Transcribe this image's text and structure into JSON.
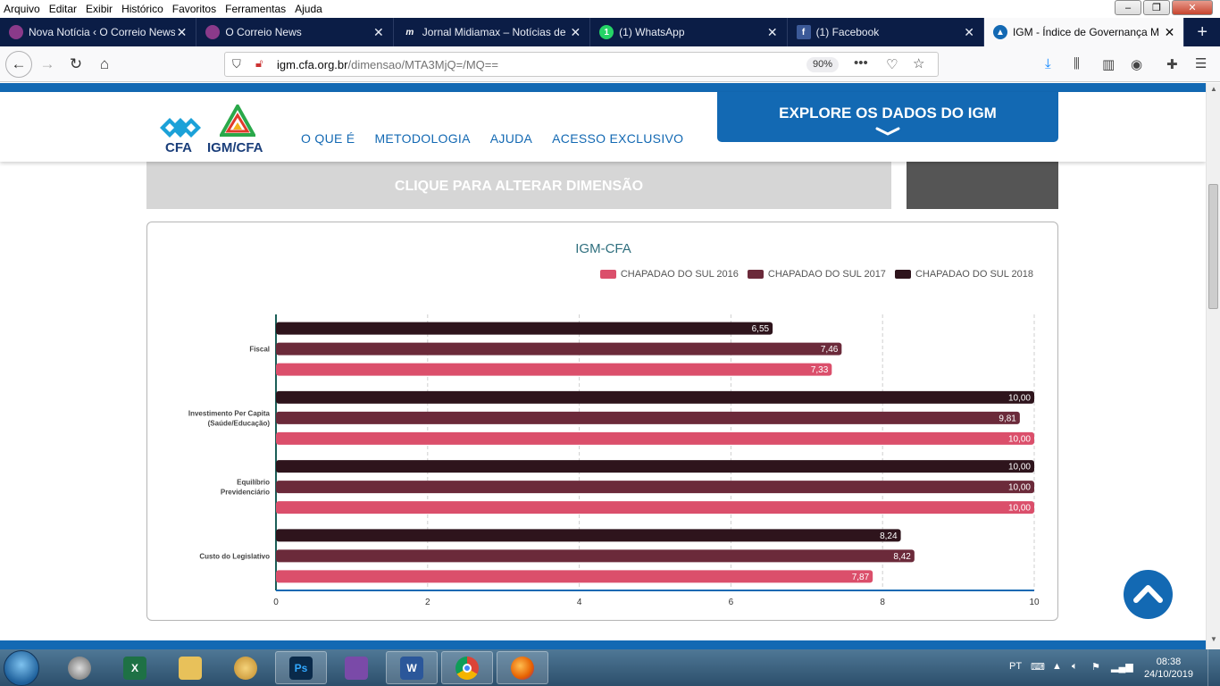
{
  "menubar": {
    "items": [
      "Arquivo",
      "Editar",
      "Exibir",
      "Histórico",
      "Favoritos",
      "Ferramentas",
      "Ajuda"
    ]
  },
  "tabs": [
    {
      "label": "Nova Notícia ‹ O Correio News",
      "icon": "correio-news-icon",
      "color": "#8a3a8a",
      "active": false
    },
    {
      "label": "O Correio News",
      "icon": "correio-news-icon",
      "color": "#8a3a8a",
      "active": false
    },
    {
      "label": "Jornal Midiamax – Notícias de",
      "icon": "midiamax-icon",
      "color": "#ffffff",
      "active": false
    },
    {
      "label": "(1) WhatsApp",
      "icon": "whatsapp-icon",
      "color": "#25d366",
      "active": false
    },
    {
      "label": "(1) Facebook",
      "icon": "facebook-icon",
      "color": "#3b5998",
      "active": false
    },
    {
      "label": "IGM - Índice de Governança M",
      "icon": "igm-icon",
      "color": "#1369b3",
      "active": true
    }
  ],
  "navbar": {
    "url_domain": "igm.cfa.org.br",
    "url_path": "/dimensao/MTA3MjQ=/MQ==",
    "zoom": "90%"
  },
  "site": {
    "logo_cfa_text": "CFA",
    "logo_igm_text": "IGM/CFA",
    "nav": [
      "O QUE É",
      "METODOLOGIA",
      "AJUDA",
      "ACESSO EXCLUSIVO"
    ],
    "explore_label": "EXPLORE OS DADOS DO IGM",
    "dimension_button": "CLIQUE PARA ALTERAR DIMENSÃO",
    "brand_color": "#1369b3"
  },
  "chart_data": {
    "type": "bar",
    "orientation": "horizontal",
    "title": "IGM-CFA",
    "categories": [
      "Fiscal",
      "Investimento Per Capita (Saúde/Educação)",
      "Equilíbrio Previdenciário",
      "Custo do Legislativo"
    ],
    "category_lines": [
      [
        "Fiscal"
      ],
      [
        "Investimento Per Capita",
        "(Saúde/Educação)"
      ],
      [
        "Equilíbrio",
        "Previdenciário"
      ],
      [
        "Custo do Legislativo"
      ]
    ],
    "series": [
      {
        "name": "CHAPADAO DO SUL 2018",
        "color": "#2e141c",
        "values": [
          6.55,
          10.0,
          10.0,
          8.24
        ],
        "labels": [
          "6,55",
          "10,00",
          "10,00",
          "8,24"
        ]
      },
      {
        "name": "CHAPADAO DO SUL 2017",
        "color": "#6b2a3a",
        "values": [
          7.46,
          9.81,
          10.0,
          8.42
        ],
        "labels": [
          "7,46",
          "9,81",
          "10,00",
          "8,42"
        ]
      },
      {
        "name": "CHAPADAO DO SUL 2016",
        "color": "#db4f6b",
        "values": [
          7.33,
          10.0,
          10.0,
          7.87
        ],
        "labels": [
          "7,33",
          "10,00",
          "10,00",
          "7,87"
        ]
      }
    ],
    "legend": [
      "CHAPADAO DO SUL 2016",
      "CHAPADAO DO SUL 2017",
      "CHAPADAO DO SUL 2018"
    ],
    "legend_colors": [
      "#db4f6b",
      "#6b2a3a",
      "#2e141c"
    ],
    "xlim": [
      0,
      10
    ],
    "xticks": [
      "0",
      "2",
      "4",
      "6",
      "8",
      "10"
    ],
    "grid": true,
    "legend_position": "top-right"
  },
  "taskbar": {
    "apps": [
      {
        "name": "start-icon",
        "label": ""
      },
      {
        "name": "app-icon-1",
        "label": ""
      },
      {
        "name": "excel-icon",
        "label": "X"
      },
      {
        "name": "explorer-icon",
        "label": ""
      },
      {
        "name": "paint-icon",
        "label": ""
      },
      {
        "name": "photoshop-icon",
        "label": "Ps"
      },
      {
        "name": "movie-maker-icon",
        "label": ""
      },
      {
        "name": "word-icon",
        "label": "W"
      },
      {
        "name": "chrome-icon",
        "label": ""
      },
      {
        "name": "firefox-icon",
        "label": ""
      }
    ],
    "lang": "PT",
    "time": "08:38",
    "date": "24/10/2019"
  }
}
